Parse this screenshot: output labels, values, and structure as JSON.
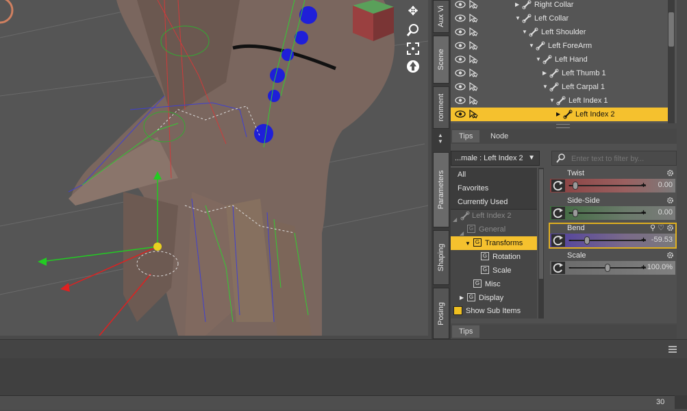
{
  "vertical_tabs": [
    "Aux Vi",
    "Scene",
    "ronment",
    "Parameters",
    "Shaping",
    "Posing"
  ],
  "scene_tree": [
    {
      "label": "Right Collar",
      "expanded": false,
      "depth": 0
    },
    {
      "label": "Left Collar",
      "expanded": true,
      "depth": 0
    },
    {
      "label": "Left Shoulder",
      "expanded": true,
      "depth": 1
    },
    {
      "label": "Left ForeArm",
      "expanded": true,
      "depth": 2
    },
    {
      "label": "Left Hand",
      "expanded": true,
      "depth": 3
    },
    {
      "label": "Left Thumb 1",
      "expanded": false,
      "depth": 4
    },
    {
      "label": "Left Carpal 1",
      "expanded": true,
      "depth": 4
    },
    {
      "label": "Left Index 1",
      "expanded": true,
      "depth": 5
    },
    {
      "label": "Left Index 2",
      "expanded": false,
      "depth": 6,
      "selected": true
    }
  ],
  "panel_tabs": {
    "tips": "Tips",
    "node": "Node"
  },
  "node_selector": "...male : Left Index 2",
  "filter": {
    "placeholder": "Enter text to filter by..."
  },
  "groups": {
    "all": "All",
    "favorites": "Favorites",
    "currently_used": "Currently Used",
    "node": "Left Index 2",
    "general": "General",
    "transforms": "Transforms",
    "rotation": "Rotation",
    "scale": "Scale",
    "misc": "Misc",
    "display": "Display"
  },
  "show_sub_items": "Show Sub Items",
  "params": [
    {
      "name": "Twist",
      "value": "0.00",
      "level": 0.08
    },
    {
      "name": "Side-Side",
      "value": "0.00",
      "level": 0.08
    },
    {
      "name": "Bend",
      "value": "-59.53",
      "level": 0.23
    },
    {
      "name": "Scale",
      "value": "100.0%",
      "level": 0.5
    }
  ],
  "tips_bottom": "Tips",
  "timeline": {
    "frame": "30"
  },
  "colors": {
    "accent": "#f5c12e",
    "joint_blue": "#1f1fd8",
    "bone_green": "#22cc22",
    "bone_red": "#e03030"
  }
}
